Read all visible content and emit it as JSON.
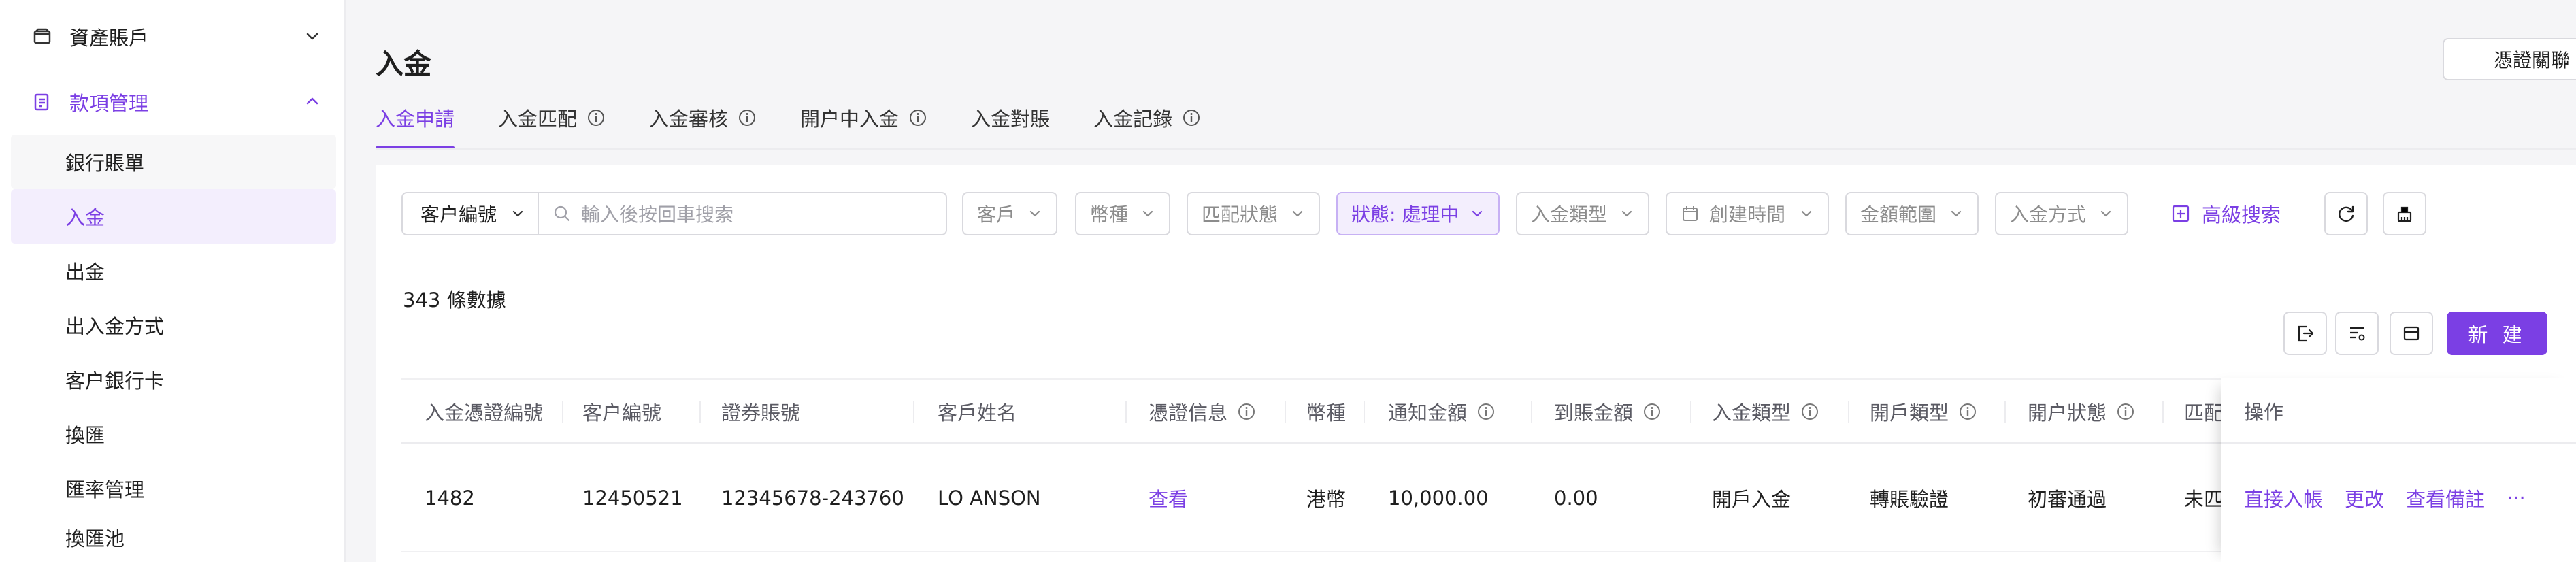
{
  "sidebar": {
    "groups": [
      {
        "label": "資產賬戶",
        "icon": "wallet-icon"
      },
      {
        "label": "款項管理",
        "icon": "document-list-icon"
      }
    ],
    "items": [
      {
        "label": "銀行賬單"
      },
      {
        "label": "入金"
      },
      {
        "label": "出金"
      },
      {
        "label": "出入金方式"
      },
      {
        "label": "客户銀行卡"
      },
      {
        "label": "換匯"
      },
      {
        "label": "匯率管理"
      },
      {
        "label": "換匯池"
      }
    ]
  },
  "header": {
    "title": "入金",
    "voucher_button": "憑證關聯"
  },
  "tabs": [
    {
      "label": "入金申請",
      "info": false
    },
    {
      "label": "入金匹配",
      "info": true
    },
    {
      "label": "入金審核",
      "info": true
    },
    {
      "label": "開户中入金",
      "info": true
    },
    {
      "label": "入金對賬",
      "info": false
    },
    {
      "label": "入金記錄",
      "info": true
    }
  ],
  "filters": {
    "search_field": "客户編號",
    "search_placeholder": "輸入後按回車搜索",
    "customer": "客戶",
    "currency": "幣種",
    "match_status": "匹配狀態",
    "status": "狀態: 處理中",
    "deposit_type": "入金類型",
    "created_time": "創建時間",
    "amount_range": "金額範圍",
    "deposit_method": "入金方式",
    "advanced_search": "高級搜索"
  },
  "summary": {
    "count_text": "343 條數據"
  },
  "toolbar": {
    "new_button": "新 建"
  },
  "table": {
    "columns": [
      "入金憑證編號",
      "客户編號",
      "證券賬號",
      "客戶姓名",
      "憑證信息",
      "幣種",
      "通知金額",
      "到賬金額",
      "入金類型",
      "開戶類型",
      "開户狀態",
      "匹配",
      "操作"
    ],
    "rows": [
      {
        "voucher_no": "1482",
        "customer_no": "12450521",
        "securities_account": "12345678-243760",
        "customer_name": "LO ANSON",
        "voucher_info": "查看",
        "currency": "港幣",
        "notified_amount": "10,000.00",
        "received_amount": "0.00",
        "deposit_type": "開戶入金",
        "account_type": "轉賬驗證",
        "account_status": "初審通過",
        "match": "未匹",
        "actions": [
          "直接入帳",
          "更改",
          "查看備註",
          "···"
        ]
      }
    ]
  },
  "colors": {
    "accent": "#7b3fe4",
    "accent_bg": "#f3eefd"
  }
}
